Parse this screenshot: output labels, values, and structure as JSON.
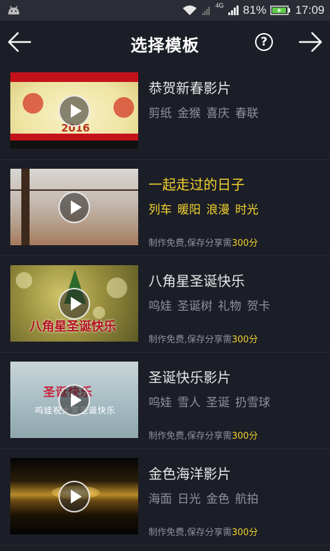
{
  "status_bar": {
    "network": "4G",
    "battery": "81%",
    "time": "17:09"
  },
  "header": {
    "title": "选择模板",
    "help": "?"
  },
  "templates": [
    {
      "name": "恭贺新春影片",
      "tags": [
        "剪纸",
        "金猴",
        "喜庆",
        "春联"
      ],
      "thumb_text": "2016",
      "note": "",
      "points": ""
    },
    {
      "name": "一起走过的日子",
      "tags": [
        "列车",
        "暖阳",
        "浪漫",
        "时光"
      ],
      "thumb_text": "",
      "note": "制作免费,保存分享需",
      "points": "300分"
    },
    {
      "name": "八角星圣诞快乐",
      "tags": [
        "呜娃",
        "圣诞树",
        "礼物",
        "贺卡"
      ],
      "thumb_text": "八角星圣诞快乐",
      "note": "制作免费,保存分享需",
      "points": "300分"
    },
    {
      "name": "圣诞快乐影片",
      "tags": [
        "呜娃",
        "雪人",
        "圣诞",
        "扔雪球"
      ],
      "thumb_text": "圣诞快乐",
      "thumb_sub": "呜娃祝大家圣诞快乐",
      "note": "制作免费,保存分享需",
      "points": "300分"
    },
    {
      "name": "金色海洋影片",
      "tags": [
        "海面",
        "日光",
        "金色",
        "航拍"
      ],
      "thumb_text": "",
      "note": "制作免费,保存分享需",
      "points": "300分"
    }
  ],
  "colors": {
    "background": "#1b1e26",
    "accent_yellow": "#f2d12f",
    "muted_text": "#8d929c"
  }
}
